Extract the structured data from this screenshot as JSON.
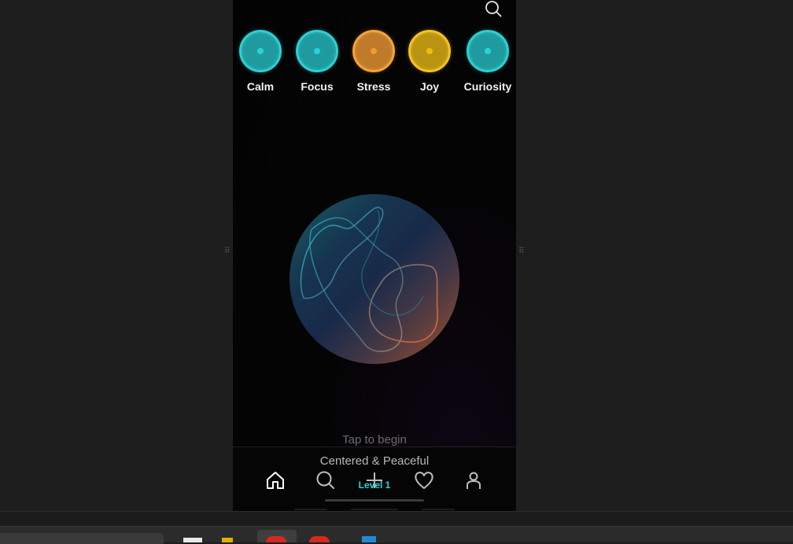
{
  "header": {
    "search_icon": "search-icon"
  },
  "moods": [
    {
      "label": "Calm",
      "ring": "#2ecfd1",
      "fill": "#1f9b9f",
      "dot": "#27d3d6"
    },
    {
      "label": "Focus",
      "ring": "#2ecfd1",
      "fill": "#1f9b9f",
      "dot": "#27d3d6"
    },
    {
      "label": "Stress",
      "ring": "#f2a33b",
      "fill": "#bf7a2a",
      "dot": "#f29a2e"
    },
    {
      "label": "Joy",
      "ring": "#f6c21f",
      "fill": "#b99412",
      "dot": "#f2b90f"
    },
    {
      "label": "Curiosity",
      "ring": "#2ecfd1",
      "fill": "#1f9b9f",
      "dot": "#27d3d6"
    }
  ],
  "main": {
    "tap_prompt": "Tap to begin"
  },
  "bottom": {
    "mood_state": "Centered & Peaceful",
    "level": "Level 1",
    "nav": [
      "home-icon",
      "search-icon",
      "plus-icon",
      "heart-icon",
      "user-icon"
    ]
  },
  "colors": {
    "accent": "#2ad4d4",
    "background": "#030303"
  }
}
